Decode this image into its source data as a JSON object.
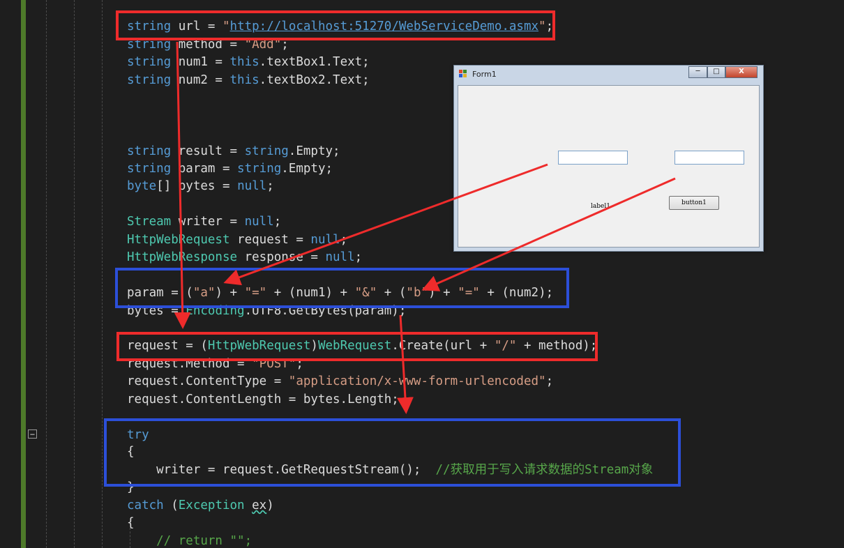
{
  "code": {
    "l1": {
      "kw": "string",
      "a": " url = ",
      "s": "\"",
      "url": "http://localhost:51270/WebServiceDemo.asmx",
      "s2": "\"",
      "end": ";"
    },
    "l2": {
      "kw": "string",
      "a": " method = ",
      "s": "\"Add\"",
      "end": ";"
    },
    "l3": {
      "kw": "string",
      "a": " num1 = ",
      "kw2": "this",
      "b": ".textBox1.Text;"
    },
    "l4": {
      "kw": "string",
      "a": " num2 = ",
      "kw2": "this",
      "b": ".textBox2.Text;"
    },
    "l5": {
      "kw": "string",
      "a": " result = ",
      "kw2": "string",
      "b": ".Empty;"
    },
    "l6": {
      "kw": "string",
      "a": " param = ",
      "kw2": "string",
      "b": ".Empty;"
    },
    "l7": {
      "kw": "byte",
      "a": "[] bytes = ",
      "kw2": "null",
      "b": ";"
    },
    "l8": {
      "ty": "Stream",
      "a": " writer = ",
      "kw2": "null",
      "b": ";"
    },
    "l9": {
      "ty": "HttpWebRequest",
      "a": " request = ",
      "kw2": "null",
      "b": ";"
    },
    "l10": {
      "ty": "HttpWebResponse",
      "a": " response = ",
      "kw2": "null",
      "b": ";"
    },
    "l11": {
      "a": "param = (",
      "s1": "\"a\"",
      "b": ") + ",
      "s2": "\"=\"",
      "c": " + (num1) + ",
      "s3": "\"&\"",
      "d": " + (",
      "s4": "\"b\"",
      "e": ") + ",
      "s5": "\"=\"",
      "f": " + (num2);"
    },
    "l12": {
      "a": "bytes = ",
      "ty": "Encoding",
      "b": ".UTF8.GetBytes(param);"
    },
    "l13": {
      "a": "request = (",
      "ty": "HttpWebRequest",
      "b": ")",
      "ty2": "WebRequest",
      "c": ".Create(url + ",
      "s": "\"/\"",
      "d": " + method);"
    },
    "l14": {
      "a": "request.Method = ",
      "s": "\"POST\"",
      "b": ";"
    },
    "l15": {
      "a": "request.ContentType = ",
      "s": "\"application/x-www-form-urlencoded\"",
      "b": ";"
    },
    "l16": {
      "a": "request.ContentLength = bytes.Length;"
    },
    "l17": {
      "kw": "try"
    },
    "l18": {
      "a": "{"
    },
    "l19": {
      "a": "    writer = request.GetRequestStream();  ",
      "cm": "//获取用于写入请求数据的Stream对象"
    },
    "l20": {
      "a": "}"
    },
    "l21": {
      "kw": "catch",
      "a": " (",
      "ty": "Exception",
      "b": " ",
      "v": "ex",
      "c": ")"
    },
    "l22": {
      "a": "{"
    },
    "l23": {
      "cm": "    // return \"\";"
    }
  },
  "form": {
    "title": "Form1",
    "minimize": "─",
    "maximize": "□",
    "close": "X",
    "label": "label1",
    "button": "button1"
  },
  "colors": {
    "highlight_red": "#ee2b2b",
    "highlight_blue": "#2c4fd8",
    "keyword": "#569cd6",
    "type": "#4ec9b0",
    "string": "#d69d85",
    "comment": "#57a64a"
  }
}
